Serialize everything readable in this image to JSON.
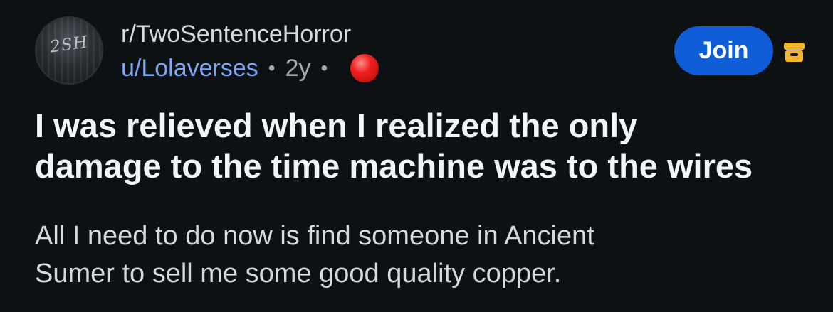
{
  "post": {
    "subreddit": "r/TwoSentenceHorror",
    "avatar_text": "2SH",
    "username": "u/Lolaverses",
    "separator": "•",
    "age": "2y",
    "title_lines": [
      "I was relieved when I realized the only",
      "damage to the time machine was to the wires"
    ],
    "body_lines": [
      "All I need to do now is find someone in Ancient",
      "Sumer to sell me some good quality copper."
    ],
    "join_label": "Join"
  },
  "icons": {
    "status": "red-circle-icon",
    "archive": "archive-icon"
  },
  "colors": {
    "background": "#0e1113",
    "username": "#7aa8f5",
    "join_button": "#0f5dd7",
    "archive_icon": "#f5b42a",
    "red_dot": "#ee1f1f"
  }
}
